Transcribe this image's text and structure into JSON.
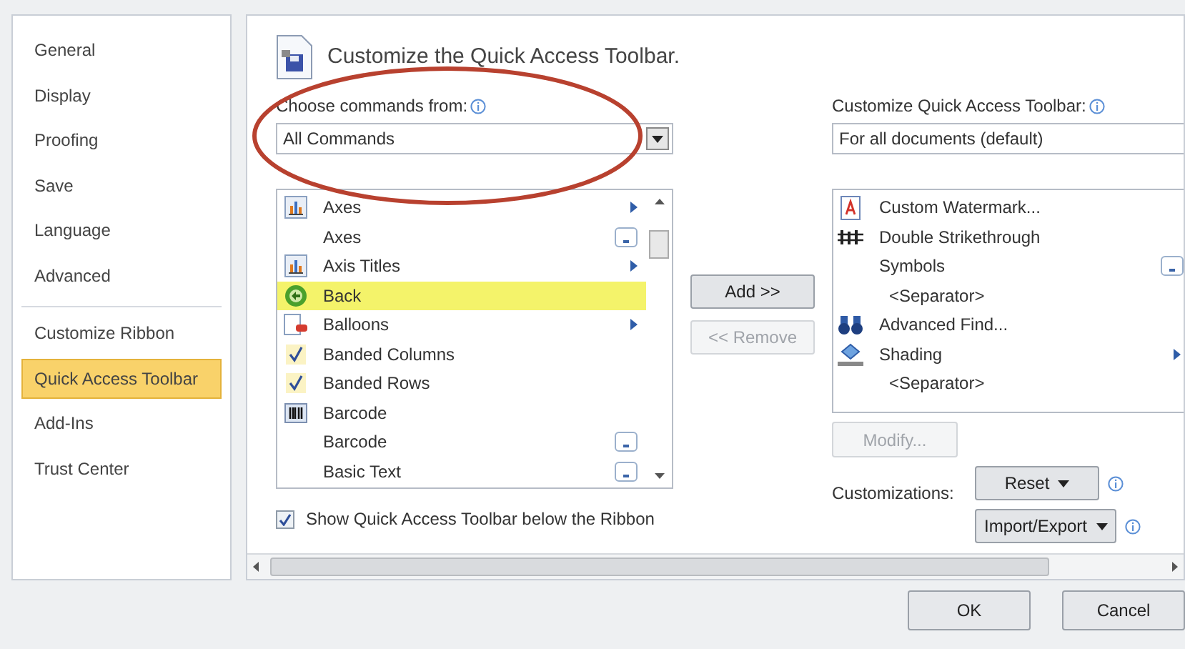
{
  "sidebar": {
    "items": [
      {
        "label": "General",
        "selected": false,
        "group_end": false
      },
      {
        "label": "Display",
        "selected": false,
        "group_end": false
      },
      {
        "label": "Proofing",
        "selected": false,
        "group_end": false
      },
      {
        "label": "Save",
        "selected": false,
        "group_end": false
      },
      {
        "label": "Language",
        "selected": false,
        "group_end": false
      },
      {
        "label": "Advanced",
        "selected": false,
        "group_end": true
      },
      {
        "label": "Customize Ribbon",
        "selected": false,
        "group_end": false
      },
      {
        "label": "Quick Access Toolbar",
        "selected": true,
        "group_end": false
      },
      {
        "label": "Add-Ins",
        "selected": false,
        "group_end": false
      },
      {
        "label": "Trust Center",
        "selected": false,
        "group_end": false
      }
    ]
  },
  "page_title": "Customize the Quick Access Toolbar.",
  "choose_label": "Choose commands from:",
  "choose_select": {
    "value": "All Commands"
  },
  "commands": [
    {
      "label": "Axes",
      "kind": "chart",
      "submenu": true,
      "expandable": false,
      "highlighted": false
    },
    {
      "label": "Axes",
      "kind": "plain",
      "submenu": false,
      "expandable": true,
      "highlighted": false
    },
    {
      "label": "Axis Titles",
      "kind": "chart",
      "submenu": true,
      "expandable": false,
      "highlighted": false
    },
    {
      "label": "Back",
      "kind": "back",
      "submenu": false,
      "expandable": false,
      "highlighted": true
    },
    {
      "label": "Balloons",
      "kind": "balloon",
      "submenu": true,
      "expandable": false,
      "highlighted": false
    },
    {
      "label": "Banded Columns",
      "kind": "check",
      "submenu": false,
      "expandable": false,
      "highlighted": false
    },
    {
      "label": "Banded Rows",
      "kind": "check",
      "submenu": false,
      "expandable": false,
      "highlighted": false
    },
    {
      "label": "Barcode",
      "kind": "barcode",
      "submenu": false,
      "expandable": false,
      "highlighted": false
    },
    {
      "label": "Barcode",
      "kind": "plain",
      "submenu": false,
      "expandable": true,
      "highlighted": false
    },
    {
      "label": "Basic Text",
      "kind": "plain",
      "submenu": false,
      "expandable": true,
      "highlighted": false
    }
  ],
  "add_button": {
    "label": "Add >>",
    "disabled": false
  },
  "remove_button": {
    "label": "<< Remove",
    "disabled": true
  },
  "show_below": {
    "label": "Show Quick Access Toolbar below the Ribbon",
    "checked": true
  },
  "toolbar_label": "Customize Quick Access Toolbar:",
  "toolbar_select": {
    "value": "For all documents (default)"
  },
  "toolbar_items": [
    {
      "label": "Custom Watermark...",
      "kind": "watermark",
      "submenu": false,
      "expandable": false,
      "indent": false
    },
    {
      "label": "Double Strikethrough",
      "kind": "strike",
      "submenu": false,
      "expandable": false,
      "indent": false
    },
    {
      "label": "Symbols",
      "kind": "plain",
      "submenu": false,
      "expandable": true,
      "indent": false
    },
    {
      "label": "<Separator>",
      "kind": "plain",
      "submenu": false,
      "expandable": false,
      "indent": true
    },
    {
      "label": "Advanced Find...",
      "kind": "binoculars",
      "submenu": false,
      "expandable": false,
      "indent": false
    },
    {
      "label": "Shading",
      "kind": "bucket",
      "submenu": true,
      "expandable": false,
      "indent": false
    },
    {
      "label": "<Separator>",
      "kind": "plain",
      "submenu": false,
      "expandable": false,
      "indent": true
    }
  ],
  "modify_button": {
    "label": "Modify...",
    "disabled": true
  },
  "customizations_label": "Customizations:",
  "reset_button": {
    "label": "Reset"
  },
  "import_export_button": {
    "label": "Import/Export"
  },
  "footer_buttons": [
    "OK",
    "Cancel"
  ]
}
